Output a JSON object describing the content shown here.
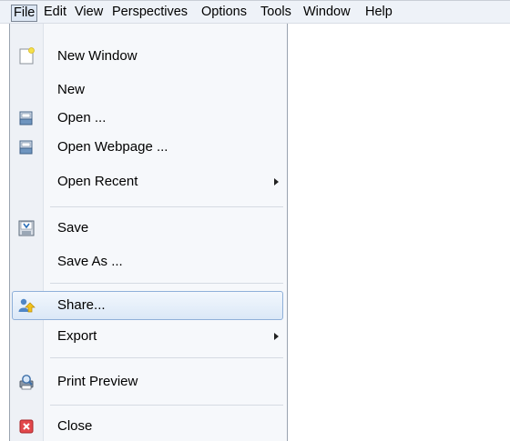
{
  "menubar": {
    "items": [
      "File",
      "Edit",
      "View",
      "Perspectives",
      "Options",
      "Tools",
      "Window",
      "Help"
    ],
    "active": "File"
  },
  "file_menu": {
    "items": [
      {
        "label": "New Window",
        "icon": "new-window-icon",
        "submenu": false
      },
      {
        "label": "New",
        "icon": null,
        "submenu": false
      },
      {
        "label": "Open ...",
        "icon": "open-folder-icon",
        "submenu": false
      },
      {
        "label": "Open Webpage ...",
        "icon": "open-webpage-icon",
        "submenu": false
      },
      {
        "label": "Open Recent",
        "icon": null,
        "submenu": true
      },
      {
        "label": "Save",
        "icon": "save-icon",
        "submenu": false
      },
      {
        "label": "Save As ...",
        "icon": null,
        "submenu": false
      },
      {
        "label": "Share...",
        "icon": "share-icon",
        "submenu": false,
        "highlighted": true
      },
      {
        "label": "Export",
        "icon": null,
        "submenu": true
      },
      {
        "label": "Print Preview",
        "icon": "print-preview-icon",
        "submenu": false
      },
      {
        "label": "Close",
        "icon": "close-icon",
        "submenu": false
      }
    ]
  }
}
